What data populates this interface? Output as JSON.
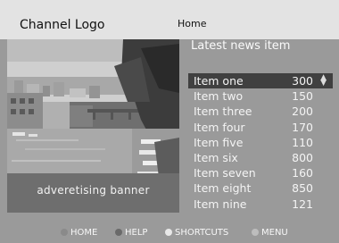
{
  "header": {
    "logo": "Channel Logo",
    "breadcrumb": "Home"
  },
  "banner": {
    "caption": "adveretising banner"
  },
  "news": {
    "headline": "Latest news item"
  },
  "items": [
    {
      "name": "Item one",
      "value": "300"
    },
    {
      "name": "Item two",
      "value": "150"
    },
    {
      "name": "Item three",
      "value": "200"
    },
    {
      "name": "Item four",
      "value": "170"
    },
    {
      "name": "Item five",
      "value": "110"
    },
    {
      "name": "Item six",
      "value": "800"
    },
    {
      "name": "Item seven",
      "value": "160"
    },
    {
      "name": "Item eight",
      "value": "850"
    },
    {
      "name": "Item nine",
      "value": "121"
    }
  ],
  "footer": {
    "home": "HOME",
    "help": "HELP",
    "shortcuts": "SHORTCUTS",
    "menu": "MENU"
  },
  "colors": {
    "home_dot": "#8a8a8a",
    "help_dot": "#6a6a6a",
    "shortcuts_dot": "#e8e8e8",
    "menu_dot": "#bdbdbd"
  }
}
